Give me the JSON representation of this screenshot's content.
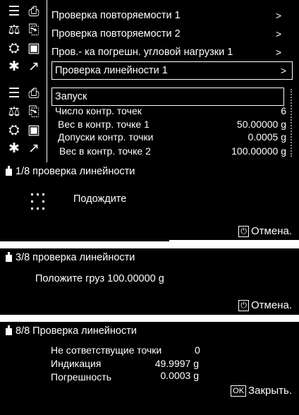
{
  "screen1": {
    "menu": [
      {
        "label": "Проверка повторяемости 1",
        "chev": ">"
      },
      {
        "label": "Проверка повторяемости  2",
        "chev": ">"
      },
      {
        "label": "Пров.- ка погрешн. угловой нагрузки 1",
        "chev": ">"
      },
      {
        "label": "Проверка линейности 1",
        "chev": ">",
        "selected": true
      }
    ],
    "icons": [
      "list-icon",
      "printer-icon",
      "balance-icon",
      "adjust-icon",
      "settings-gear-icon",
      "graph-icon",
      "scale-icon",
      "weight-icon"
    ]
  },
  "screen2": {
    "start_label": "Запуск",
    "rows": [
      {
        "label": "Число контр. точек",
        "value": "6"
      },
      {
        "label": "Вес в контр. точке 1",
        "value": "50.00000 g"
      },
      {
        "label": "Допуски контр. точки",
        "value": "0.0005 g"
      },
      {
        "label": "Вес в контр. точке 2",
        "value": "100.00000 g"
      }
    ]
  },
  "screen3": {
    "title": "1/8 проверка линейности",
    "message": "Подождите",
    "cancel": "Отмена."
  },
  "screen4": {
    "title": "3/8 проверка линейности",
    "message": "Положите груз 100.00000 g",
    "cancel": "Отмена."
  },
  "screen5": {
    "title": "8/8 Проверка линейности",
    "rows": [
      {
        "label": "Не сответствущие точки",
        "value": "0"
      },
      {
        "label": "Индикация",
        "value": "49.9997 g"
      },
      {
        "label": "Погрешность",
        "value": "0.0003 g"
      }
    ],
    "ok_key": "OK",
    "close": "Закрыть."
  },
  "colors": {
    "background": "#000000",
    "foreground": "#ffffff"
  }
}
